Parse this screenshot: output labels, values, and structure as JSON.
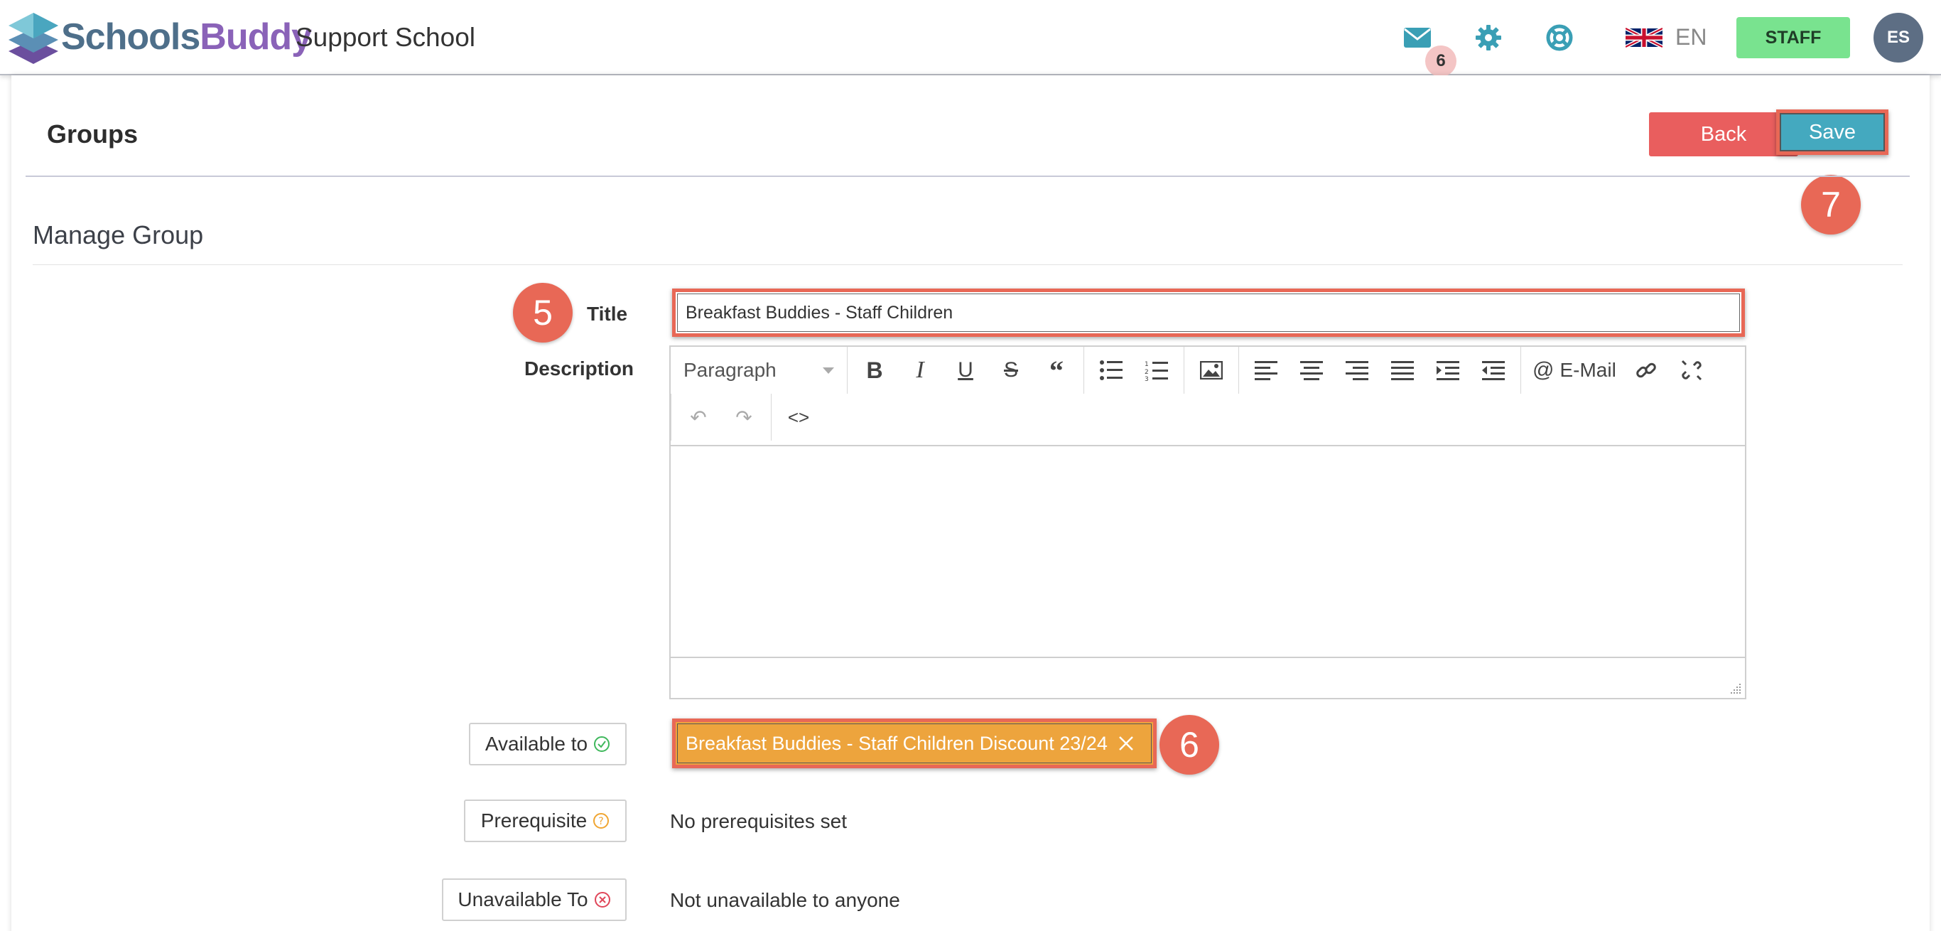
{
  "header": {
    "brand_part1": "Schools",
    "brand_part2": "Buddy",
    "school_name": "Support School",
    "mail_badge": "6",
    "language": "EN",
    "staff_label": "STAFF",
    "avatar_initials": "ES",
    "icons": [
      "logo-icon",
      "mail-icon",
      "gear-icon",
      "help-icon",
      "uk-flag-icon"
    ]
  },
  "page": {
    "title": "Groups",
    "back_label": "Back",
    "save_label": "Save",
    "section_title": "Manage Group"
  },
  "callouts": {
    "title_step": "5",
    "available_step": "6",
    "save_step": "7"
  },
  "form": {
    "title_label": "Title",
    "title_value": "Breakfast Buddies - Staff Children",
    "description_label": "Description",
    "available_label": "Available to",
    "available_tag": "Breakfast Buddies - Staff Children Discount 23/24",
    "prerequisite_label": "Prerequisite",
    "prerequisite_value": "No prerequisites set",
    "unavailable_label": "Unavailable To",
    "unavailable_value": "Not unavailable to anyone"
  },
  "editor": {
    "format_select": "Paragraph",
    "email_label": "E-Mail",
    "toolbar_icons": [
      "bold-icon",
      "italic-icon",
      "underline-icon",
      "strikethrough-icon",
      "blockquote-icon",
      "bullet-list-icon",
      "numbered-list-icon",
      "image-icon",
      "align-left-icon",
      "align-center-icon",
      "align-right-icon",
      "align-justify-icon",
      "indent-icon",
      "outdent-icon",
      "at-icon",
      "link-icon",
      "unlink-icon",
      "undo-icon",
      "redo-icon",
      "code-icon"
    ]
  },
  "colors": {
    "back_button": "#e95e5e",
    "save_button": "#44a9bf",
    "staff_button": "#79e38f",
    "callout": "#e86856",
    "tag": "#eda43d",
    "accent_icons": "#3a9fb5"
  }
}
